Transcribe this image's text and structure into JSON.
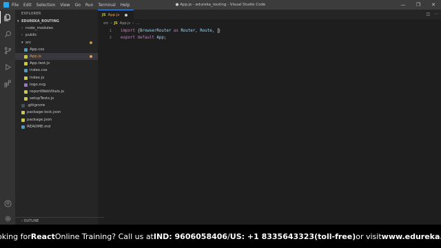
{
  "titlebar": {
    "menu": [
      "File",
      "Edit",
      "Selection",
      "View",
      "Go",
      "Run",
      "Terminal",
      "Help"
    ],
    "title": "● App.js - edureka_routing - Visual Studio Code",
    "controls": [
      "—",
      "❐",
      "✕"
    ]
  },
  "activity_bar": {
    "items": [
      "explorer-icon",
      "search-icon",
      "source-control-icon",
      "run-debug-icon",
      "extensions-icon"
    ],
    "bottom": [
      "account-icon",
      "settings-gear-icon"
    ]
  },
  "sidebar": {
    "header": "EXPLORER",
    "root": "EDUREKA_ROUTING",
    "items": [
      {
        "label": "node_modules",
        "type": "folder",
        "depth": 1
      },
      {
        "label": "public",
        "type": "folder",
        "depth": 1
      },
      {
        "label": "src",
        "type": "folder-open",
        "depth": 1
      },
      {
        "label": "App.css",
        "type": "css",
        "depth": 2
      },
      {
        "label": "App.js",
        "type": "js",
        "depth": 2,
        "active": true
      },
      {
        "label": "App.test.js",
        "type": "js",
        "depth": 2
      },
      {
        "label": "index.css",
        "type": "css",
        "depth": 2
      },
      {
        "label": "index.js",
        "type": "js",
        "depth": 2
      },
      {
        "label": "logo.svg",
        "type": "svg",
        "depth": 2
      },
      {
        "label": "reportWebVitals.js",
        "type": "js",
        "depth": 2
      },
      {
        "label": "setupTests.js",
        "type": "js",
        "depth": 2
      },
      {
        "label": ".gitignore",
        "type": "git",
        "depth": 1
      },
      {
        "label": "package-lock.json",
        "type": "json",
        "depth": 1
      },
      {
        "label": "package.json",
        "type": "json",
        "depth": 1
      },
      {
        "label": "README.md",
        "type": "md",
        "depth": 1
      }
    ],
    "outline": "OUTLINE"
  },
  "tabs": [
    {
      "label": "App.js",
      "lang": "JS",
      "modified": true
    }
  ],
  "breadcrumb": {
    "folder": "src",
    "lang": "JS",
    "file": "App.js",
    "rest": "..."
  },
  "editor": {
    "line_numbers": [
      "1",
      "2"
    ],
    "line1": {
      "kw": "import",
      "brace_open": "{",
      "a": "BrowserRouter",
      "as": "as",
      "b": "Router",
      "c": "Route",
      "brace_close": "}"
    },
    "line2": {
      "kw": "export",
      "kw2": "default",
      "fn": "App"
    }
  },
  "banner": {
    "prefix": "Looking for ",
    "strong1": "React",
    "mid": " Online Training? Call us at ",
    "strong2": "IND: 9606058406",
    "mid2": " / ",
    "strong3": "US: +1 8335643323(toll-free)",
    "mid3": " or visit ",
    "strong4": "www.edureka.co"
  },
  "colors": {
    "accent": "#3794ff",
    "js": "#cbcb41",
    "modified": "#e2a15c"
  }
}
